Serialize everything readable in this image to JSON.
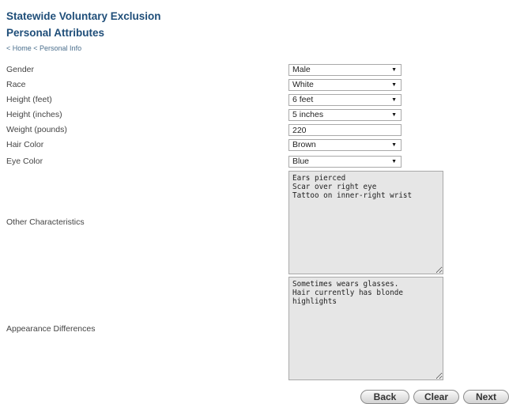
{
  "header": {
    "title": "Statewide Voluntary Exclusion",
    "subtitle": "Personal Attributes"
  },
  "breadcrumb": {
    "home": "< Home",
    "current": "< Personal Info"
  },
  "fields": {
    "gender": {
      "label": "Gender",
      "value": "Male"
    },
    "race": {
      "label": "Race",
      "value": "White"
    },
    "height_feet": {
      "label": "Height (feet)",
      "value": "6 feet"
    },
    "height_inches": {
      "label": "Height (inches)",
      "value": "5 inches"
    },
    "weight": {
      "label": "Weight (pounds)",
      "value": "220"
    },
    "hair": {
      "label": "Hair Color",
      "value": "Brown"
    },
    "eye": {
      "label": "Eye Color",
      "value": "Blue"
    },
    "other": {
      "label": "Other Characteristics",
      "value": "Ears pierced\nScar over right eye\nTattoo on inner-right wrist"
    },
    "appearance": {
      "label": "Appearance Differences",
      "value": "Sometimes wears glasses.\nHair currently has blonde\nhighlights"
    }
  },
  "buttons": {
    "back": "Back",
    "clear": "Clear",
    "next": "Next"
  },
  "icons": {
    "dropdown": "chevron-down-icon"
  },
  "colors": {
    "title": "#1f4e79",
    "breadcrumb": "#4a6e8c",
    "textarea_bg": "#e6e6e6"
  }
}
